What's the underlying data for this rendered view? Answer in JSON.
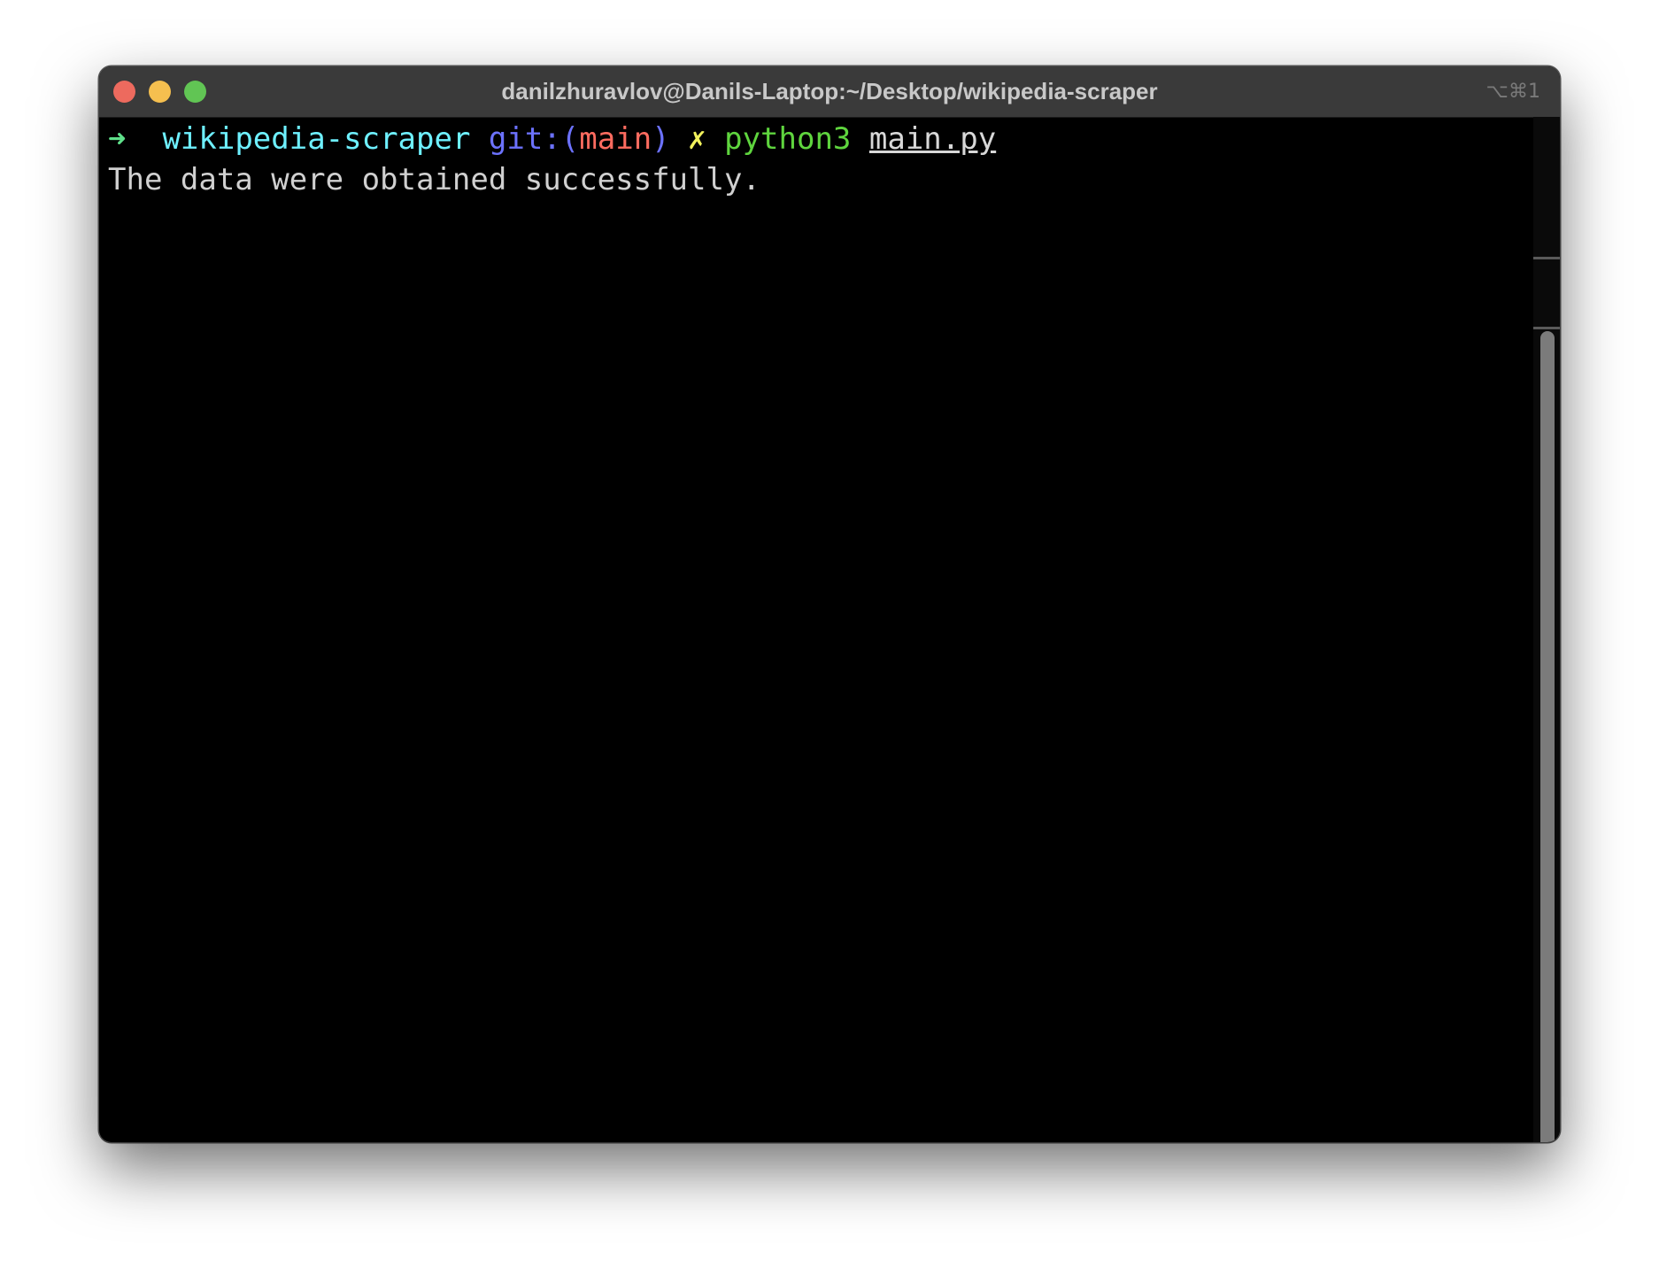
{
  "window": {
    "title": "danilzhuravlov@Danils-Laptop:~/Desktop/wikipedia-scraper",
    "shortcut": "⌥⌘1"
  },
  "terminal": {
    "prompt": {
      "arrow": "➜",
      "directory": "wikipedia-scraper",
      "git_prefix": "git:(",
      "branch": "main",
      "git_suffix": ")",
      "dirty_marker": "✗",
      "command": "python3",
      "argument": "main.py"
    },
    "output": "The data were obtained successfully."
  },
  "colors": {
    "arrow": "#5fe08a",
    "directory": "#6ef0ff",
    "git": "#6c72ff",
    "branch": "#ff6c60",
    "dirty": "#f2f25c",
    "command": "#5fd53e",
    "close": "#ed6a5e",
    "minimize": "#f5bf4f",
    "zoom": "#61c554"
  }
}
